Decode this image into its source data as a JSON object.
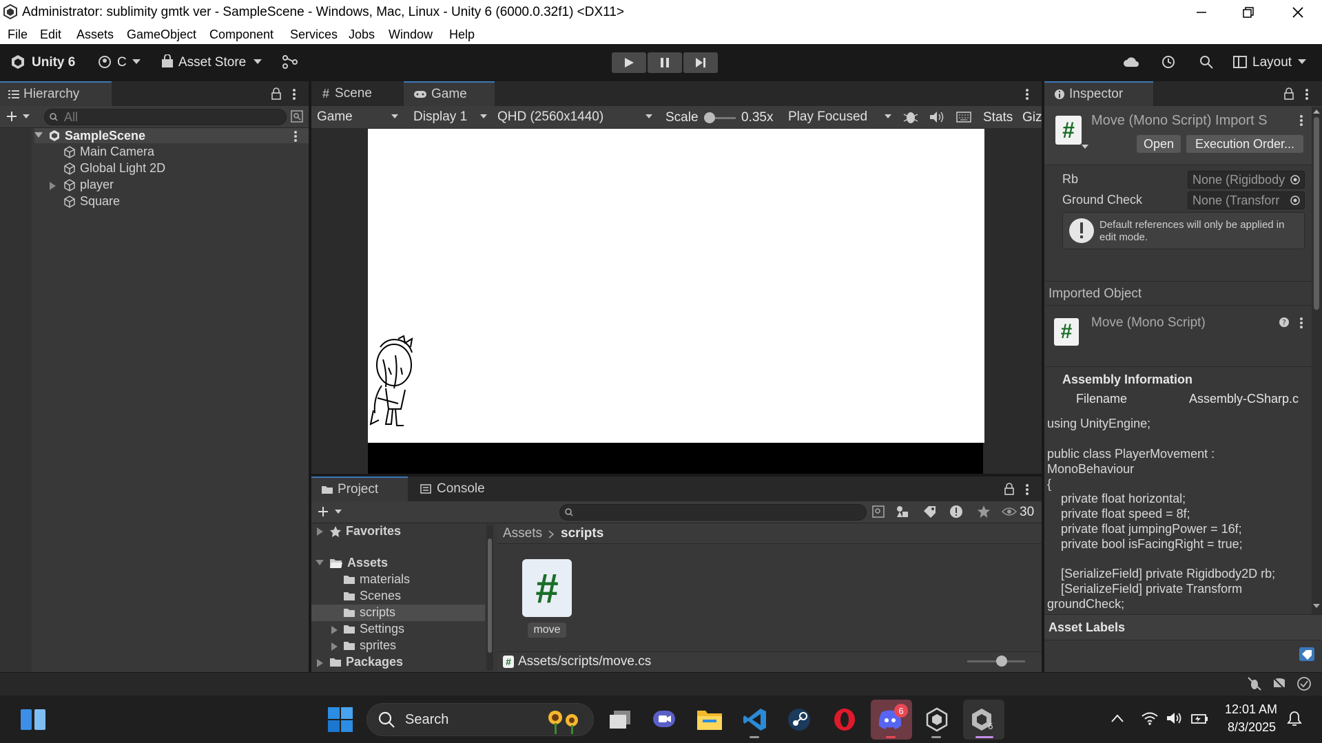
{
  "window": {
    "title": "Administrator: sublimity gmtk ver - SampleScene - Windows, Mac, Linux - Unity 6 (6000.0.32f1) <DX11>"
  },
  "menu": [
    "File",
    "Edit",
    "Assets",
    "GameObject",
    "Component",
    "Services",
    "Jobs",
    "Window",
    "Help"
  ],
  "toolbar": {
    "unity_label": "Unity 6",
    "account_label": "C",
    "asset_store_label": "Asset Store",
    "layout_label": "Layout"
  },
  "hierarchy": {
    "tab_label": "Hierarchy",
    "search_placeholder": "All",
    "scene_name": "SampleScene",
    "items": [
      "Main Camera",
      "Global Light 2D",
      "player",
      "Square"
    ]
  },
  "scene_tabs": {
    "scene_label": "Scene",
    "game_label": "Game"
  },
  "game_toolbar": {
    "mode": "Game",
    "display": "Display 1",
    "resolution": "QHD (2560x1440)",
    "scale_label": "Scale",
    "scale_value": "0.35x",
    "play_mode": "Play Focused",
    "stats_label": "Stats",
    "gizmos_label": "Giz"
  },
  "project": {
    "tab_label": "Project",
    "console_label": "Console",
    "hidden_count": "30",
    "favorites_label": "Favorites",
    "assets_label": "Assets",
    "folders": [
      "materials",
      "Scenes",
      "scripts",
      "Settings",
      "sprites"
    ],
    "packages_label": "Packages",
    "breadcrumb": [
      "Assets",
      "scripts"
    ],
    "file_name": "move",
    "path": "Assets/scripts/move.cs"
  },
  "inspector": {
    "tab_label": "Inspector",
    "header_title": "Move (Mono Script) Import S",
    "open_label": "Open",
    "execution_order_label": "Execution Order...",
    "fields": [
      {
        "label": "Rb",
        "value": "None (Rigidbody"
      },
      {
        "label": "Ground Check",
        "value": "None (Transforr"
      }
    ],
    "warning": "Default references will only be applied in edit mode.",
    "imported_object_label": "Imported Object",
    "imported_object_name": "Move (Mono Script)",
    "assembly_header": "Assembly Information",
    "filename_label": "Filename",
    "filename_value": "Assembly-CSharp.c",
    "code_lines": [
      "using UnityEngine;",
      "",
      "public class PlayerMovement :",
      "MonoBehaviour",
      "{",
      "    private float horizontal;",
      "    private float speed = 8f;",
      "    private float jumpingPower = 16f;",
      "    private bool isFacingRight = true;",
      "",
      "    [SerializeField] private Rigidbody2D rb;",
      "    [SerializeField] private Transform",
      "groundCheck;"
    ],
    "asset_labels": "Asset Labels"
  },
  "taskbar": {
    "search_label": "Search",
    "time": "12:01 AM",
    "date": "8/3/2025",
    "discord_badge": "6"
  }
}
